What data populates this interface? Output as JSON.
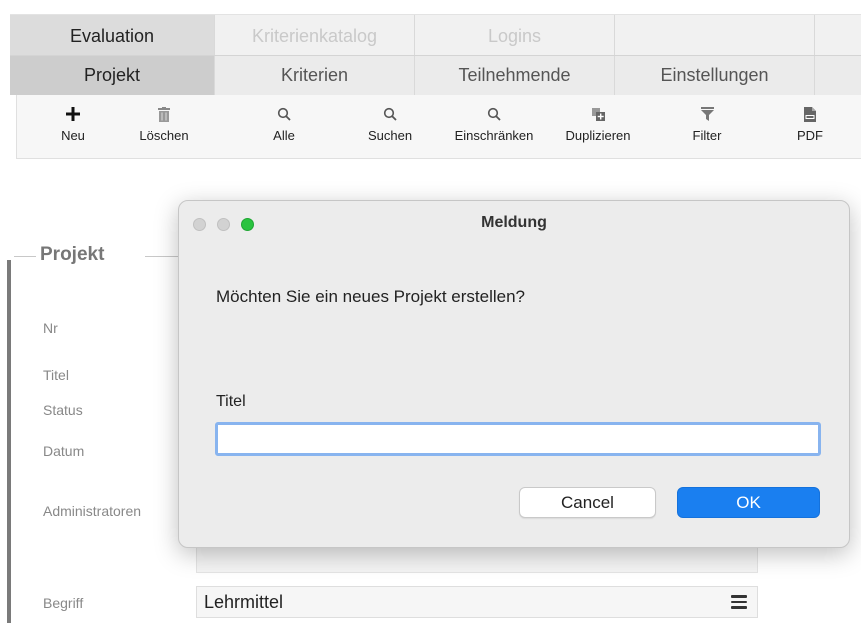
{
  "tabs_top": [
    {
      "label": "Evaluation",
      "state": "active"
    },
    {
      "label": "Kriterienkatalog",
      "state": "disabled"
    },
    {
      "label": "Logins",
      "state": "disabled"
    },
    {
      "label": "",
      "state": "empty"
    },
    {
      "label": "",
      "state": "empty"
    }
  ],
  "tabs_sub": [
    {
      "label": "Projekt",
      "state": "active"
    },
    {
      "label": "Kriterien",
      "state": "normal"
    },
    {
      "label": "Teilnehmende",
      "state": "normal"
    },
    {
      "label": "Einstellungen",
      "state": "normal"
    }
  ],
  "toolbar": {
    "new": {
      "label": "Neu",
      "icon": "plus-icon"
    },
    "delete": {
      "label": "Löschen",
      "icon": "trash-icon"
    },
    "all": {
      "label": "Alle",
      "icon": "search-icon"
    },
    "search": {
      "label": "Suchen",
      "icon": "search-icon"
    },
    "restrict": {
      "label": "Einschränken",
      "icon": "search-icon"
    },
    "duplicate": {
      "label": "Duplizieren",
      "icon": "duplicate-icon"
    },
    "filter": {
      "label": "Filter",
      "icon": "filter-icon"
    },
    "pdf": {
      "label": "PDF",
      "icon": "pdf-icon"
    }
  },
  "form": {
    "section_title": "Projekt",
    "labels": {
      "nr": "Nr",
      "titel": "Titel",
      "status": "Status",
      "datum": "Datum",
      "administratoren": "Administratoren",
      "begriff": "Begriff"
    },
    "begriff_value": "Lehrmittel"
  },
  "dialog": {
    "title": "Meldung",
    "message": "Möchten Sie ein neues Projekt erstellen?",
    "field_label": "Titel",
    "field_value": "",
    "cancel_label": "Cancel",
    "ok_label": "OK"
  },
  "colors": {
    "accent": "#1a7ff0",
    "focus_ring": "#88b4ef",
    "traffic_green": "#2ac33f"
  }
}
